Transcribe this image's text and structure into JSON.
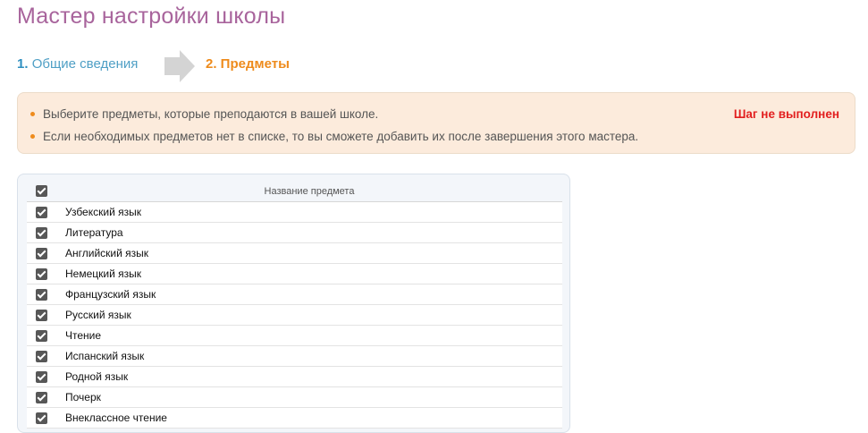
{
  "page": {
    "title": "Мастер настройки школы"
  },
  "steps": [
    {
      "number": "1.",
      "label": "Общие сведения"
    },
    {
      "label": "2. Предметы"
    }
  ],
  "info": {
    "items": [
      "Выберите предметы, которые преподаются в вашей школе.",
      "Если необходимых предметов нет в списке, то вы сможете добавить их после завершения этого мастера."
    ],
    "status": "Шаг не выполнен",
    "status_color": "#e21e1e"
  },
  "table": {
    "header": "Название предмета",
    "rows": [
      {
        "name": "Узбекский язык",
        "checked": true
      },
      {
        "name": "Литература",
        "checked": true
      },
      {
        "name": "Английский язык",
        "checked": true
      },
      {
        "name": "Немецкий язык",
        "checked": true
      },
      {
        "name": "Французский язык",
        "checked": true
      },
      {
        "name": "Русский язык",
        "checked": true
      },
      {
        "name": "Чтение",
        "checked": true
      },
      {
        "name": "Испанский язык",
        "checked": true
      },
      {
        "name": "Родной язык",
        "checked": true
      },
      {
        "name": "Почерк",
        "checked": true
      },
      {
        "name": "Внеклассное чтение",
        "checked": true
      }
    ]
  },
  "colors": {
    "title": "#a8649c",
    "step_done": "#2e8fc0",
    "step_active": "#ee8b1c",
    "info_bg": "#fcebdc"
  },
  "icons": {
    "wizard_arrow": "arrow-right-icon",
    "check": "checkbox-checked-icon",
    "bullet": "bullet-icon"
  }
}
